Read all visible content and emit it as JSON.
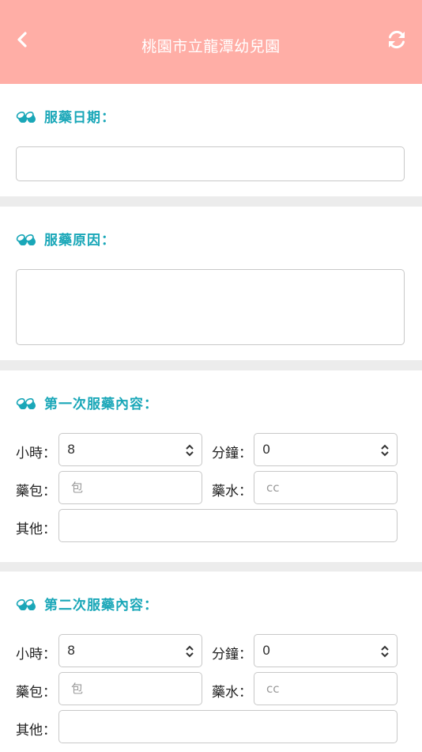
{
  "header": {
    "title": "桃園市立龍潭幼兒園",
    "back_icon": "chevron-left-icon",
    "refresh_icon": "refresh-icon",
    "background": "#ffaea6"
  },
  "accent_color": "#1aa7b8",
  "date_section": {
    "label": "服藥日期：",
    "value": ""
  },
  "reason_section": {
    "label": "服藥原因：",
    "value": ""
  },
  "doses": [
    {
      "label": "第一次服藥內容：",
      "hour_label": "小時：",
      "hour_value": "8",
      "minute_label": "分鐘：",
      "minute_value": "0",
      "packet_label": "藥包：",
      "packet_placeholder": "包",
      "liquid_label": "藥水：",
      "liquid_placeholder": "cc",
      "other_label": "其他：",
      "other_value": ""
    },
    {
      "label": "第二次服藥內容：",
      "hour_label": "小時：",
      "hour_value": "8",
      "minute_label": "分鐘：",
      "minute_value": "0",
      "packet_label": "藥包：",
      "packet_placeholder": "包",
      "liquid_label": "藥水：",
      "liquid_placeholder": "cc",
      "other_label": "其他：",
      "other_value": ""
    }
  ]
}
